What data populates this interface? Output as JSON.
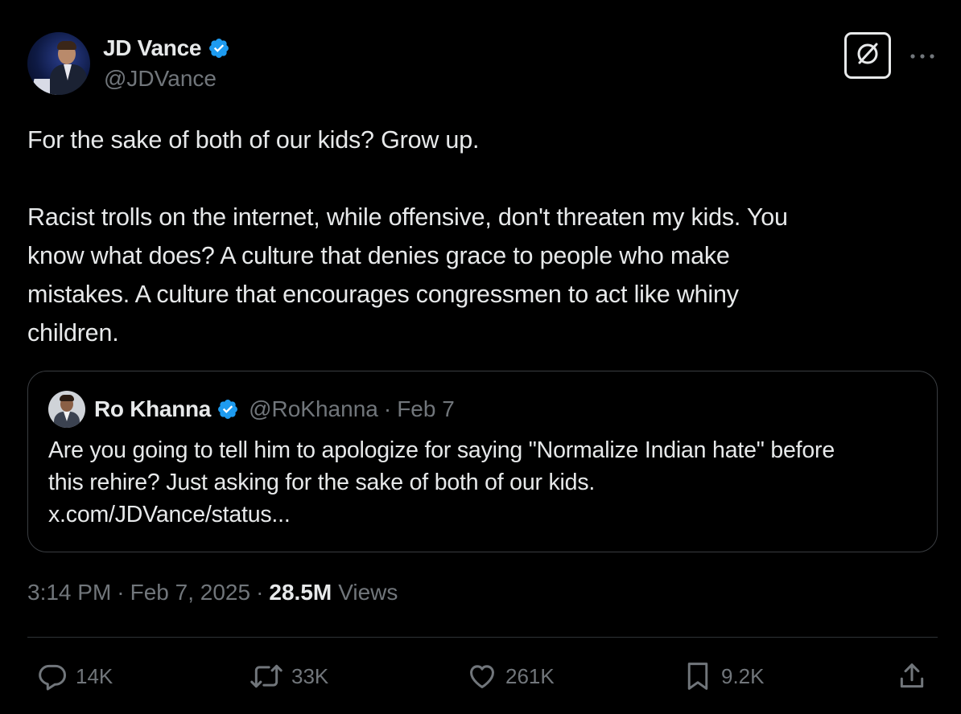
{
  "author": {
    "display_name": "JD Vance",
    "handle": "@JDVance",
    "verified_icon": "verified-badge-icon"
  },
  "header_actions": {
    "grok_icon": "grok-icon",
    "more_icon": "more-options-icon"
  },
  "tweet": {
    "paragraphs": [
      "For the sake of both of our kids? Grow up.",
      "Racist trolls on the internet, while offensive, don't threaten my kids. You know what does? A culture that denies grace to people who make mistakes. A culture that encourages congressmen to act like whiny children."
    ],
    "lines_para2": [
      "Racist trolls on the internet, while offensive, don't threaten my kids. You",
      "know what does? A culture that denies grace to people who make",
      "mistakes. A culture that encourages congressmen to act like whiny",
      "children."
    ]
  },
  "quote": {
    "display_name": "Ro Khanna",
    "handle": "@RoKhanna",
    "separator": "·",
    "date": "Feb 7",
    "lines": [
      "Are you going to tell him to apologize for saying \"Normalize Indian hate\" before",
      "this rehire? Just asking for the sake of both of our kids.",
      "x.com/JDVance/status..."
    ]
  },
  "meta": {
    "time": "3:14 PM",
    "separator": "·",
    "date": "Feb 7, 2025",
    "views_count": "28.5M",
    "views_label": "Views"
  },
  "actions": {
    "reply": "14K",
    "repost": "33K",
    "like": "261K",
    "bookmark": "9.2K"
  },
  "colors": {
    "background": "#000000",
    "text": "#e7e9ea",
    "muted": "#71767b",
    "verified": "#1d9bf0",
    "border": "#2f3336"
  }
}
